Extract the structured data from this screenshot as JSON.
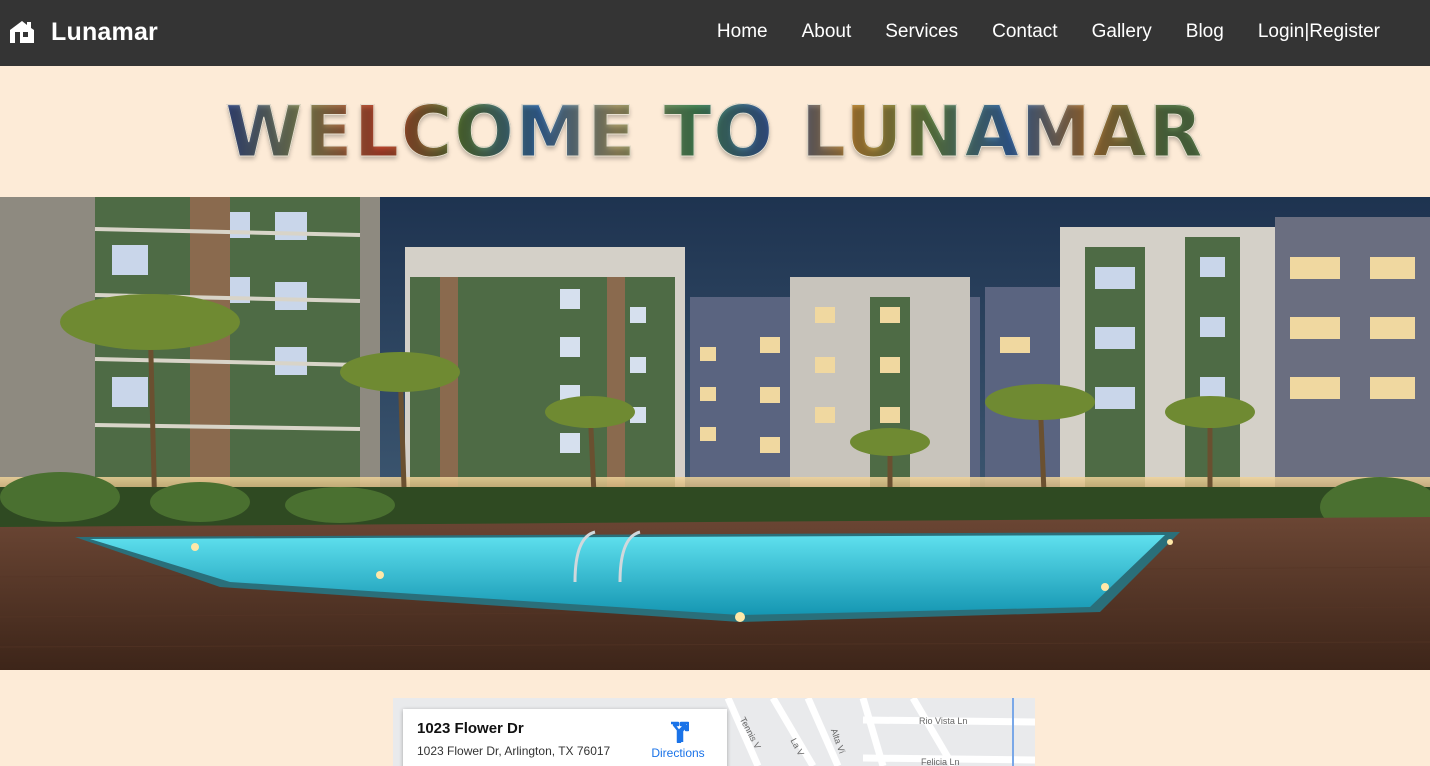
{
  "navbar": {
    "brand": "Lunamar",
    "links": [
      "Home",
      "About",
      "Services",
      "Contact",
      "Gallery",
      "Blog"
    ],
    "login": "Login",
    "separator": "|",
    "register": "Register"
  },
  "welcome": {
    "title": "WELCOME TO LUNAMAR"
  },
  "map": {
    "place_title": "1023 Flower Dr",
    "address": "1023 Flower Dr, Arlington, TX 76017",
    "directions_label": "Directions",
    "streets": [
      "Rio Vista Ln",
      "Tennis V",
      "La V",
      "Alta Vi",
      "Felicia Ln"
    ]
  },
  "colors": {
    "navbar": "#343434",
    "page_background": "#fdebd7",
    "link_blue": "#1a73e8"
  },
  "icons": {
    "brand": "home-icon",
    "directions": "directions-icon"
  }
}
